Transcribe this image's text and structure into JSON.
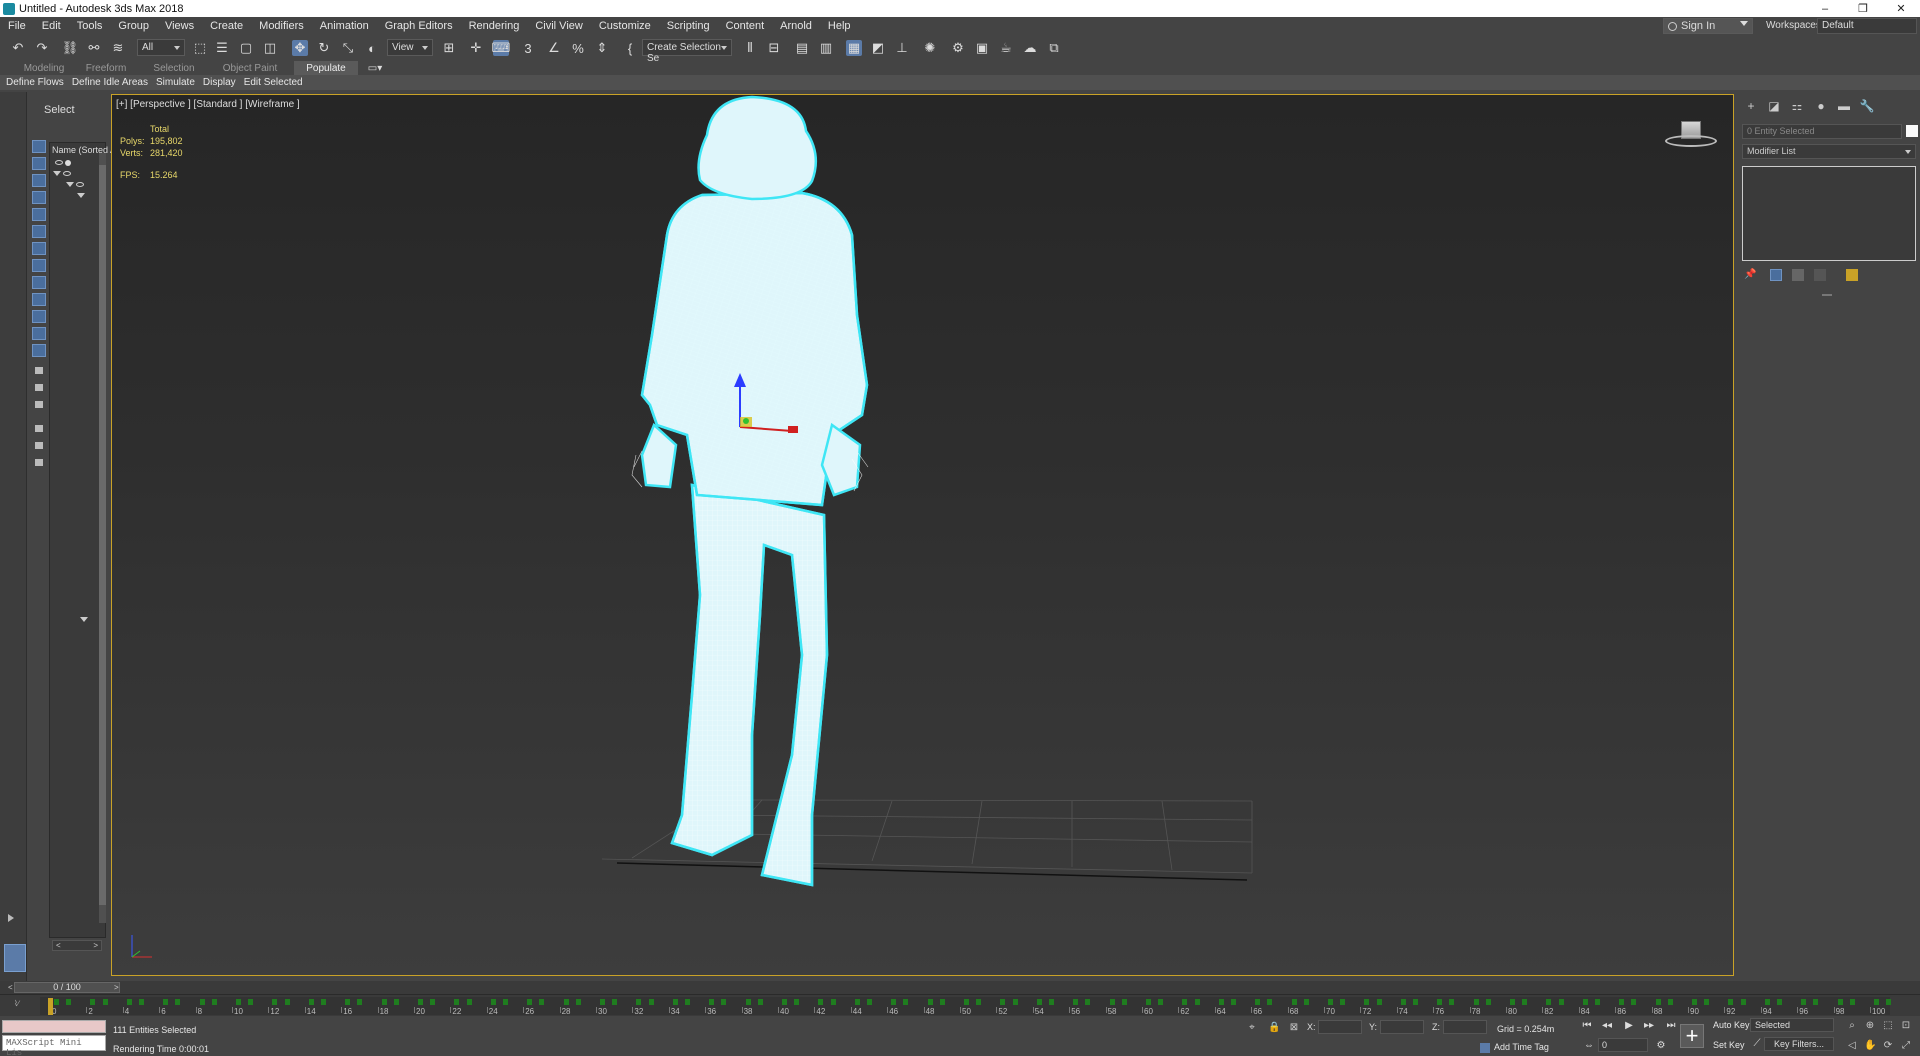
{
  "window": {
    "title": "Untitled - Autodesk 3ds Max 2018",
    "controls": [
      "–",
      "❐",
      "✕"
    ]
  },
  "menu": {
    "items": [
      "File",
      "Edit",
      "Tools",
      "Group",
      "Views",
      "Create",
      "Modifiers",
      "Animation",
      "Graph Editors",
      "Rendering",
      "Civil View",
      "Customize",
      "Scripting",
      "Content",
      "Arnold",
      "Help"
    ],
    "sign_in": "Sign In",
    "workspaces_label": "Workspaces:",
    "workspace_value": "Default"
  },
  "toolbar": {
    "selection_filter": "All",
    "ref_coord": "View",
    "named_selection": "Create Selection Se"
  },
  "ribbon": {
    "tabs": [
      "Modeling",
      "Freeform",
      "Selection",
      "Object Paint",
      "Populate"
    ],
    "active_tab": "Populate",
    "subtabs": [
      "Define Flows",
      "Define Idle Areas",
      "Simulate",
      "Display",
      "Edit Selected"
    ]
  },
  "scene_explorer": {
    "title": "Select",
    "column_header": "Name (Sorted Ascending)"
  },
  "viewport": {
    "label": "[+] [Perspective ] [Standard ] [Wireframe ]",
    "stats": {
      "total_label": "Total",
      "polys_label": "Polys:",
      "polys_value": "195,802",
      "verts_label": "Verts:",
      "verts_value": "281,420",
      "fps_label": "FPS:",
      "fps_value": "15.264"
    },
    "colors": {
      "mesh_fill": "#dff6fb",
      "mesh_outline": "#3fe6f5",
      "wire": "#ffffff",
      "frame": "#c9a227"
    }
  },
  "command_panel": {
    "name_field": "0 Entity Selected",
    "modifier_list": "Modifier List"
  },
  "timeline": {
    "position": "0 / 100",
    "frame_labels": [
      "0",
      "2",
      "4",
      "6",
      "8",
      "10",
      "12",
      "14",
      "16",
      "18",
      "20",
      "22",
      "24",
      "26",
      "28",
      "30",
      "32",
      "34",
      "36",
      "38",
      "40",
      "42",
      "44",
      "46",
      "48",
      "50",
      "52",
      "54",
      "56",
      "58",
      "60",
      "62",
      "64",
      "66",
      "68",
      "70",
      "72",
      "74",
      "76",
      "78",
      "80",
      "82",
      "84",
      "86",
      "88",
      "90",
      "92",
      "94",
      "96",
      "98",
      "100"
    ]
  },
  "status": {
    "maxscript_placeholder": "MAXScript Mini Lis",
    "selected": "111 Entities Selected",
    "rendering_time": "Rendering Time  0:00:01",
    "x_label": "X:",
    "y_label": "Y:",
    "z_label": "Z:",
    "grid": "Grid = 0.254m",
    "add_time_tag": "Add Time Tag",
    "auto_key": "Auto Key",
    "set_key": "Set Key",
    "selected_dropdown": "Selected",
    "key_filters": "Key Filters...",
    "current_frame": "0"
  }
}
